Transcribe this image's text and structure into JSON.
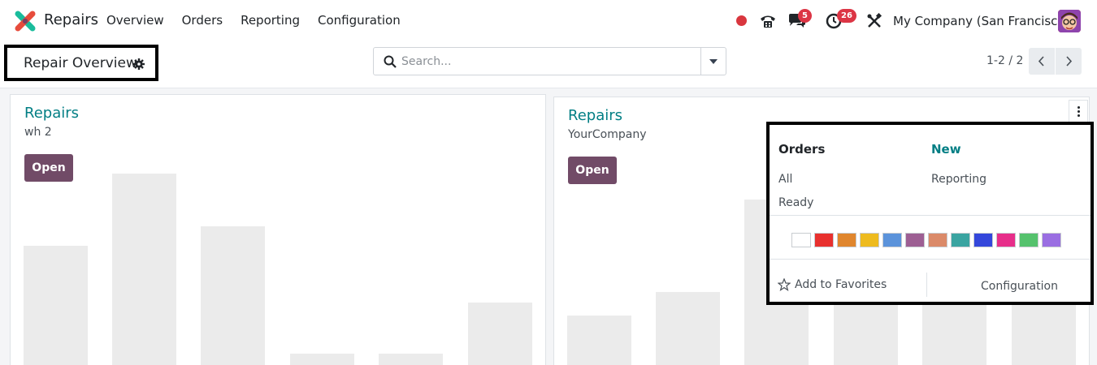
{
  "app": {
    "name": "Repairs",
    "logo_icon": "odoo-repairs-logo"
  },
  "nav": {
    "items": [
      "Overview",
      "Orders",
      "Reporting",
      "Configuration"
    ]
  },
  "systray": {
    "status_color": "#d9363e",
    "chat_count": "5",
    "activity_count": "26",
    "company": "My Company (San Francisco)"
  },
  "control_panel": {
    "title": "Repair Overview",
    "search_placeholder": "Search...",
    "pager": "1-2 / 2"
  },
  "cards": [
    {
      "name": "Repairs",
      "subtitle": "wh 2",
      "button": "Open",
      "graph_values": [
        95,
        150,
        110,
        13,
        13,
        52
      ]
    },
    {
      "name": "Repairs",
      "subtitle": "YourCompany",
      "button": "Open",
      "graph_values": [
        42,
        60,
        130,
        130,
        130,
        130
      ]
    }
  ],
  "dropdown": {
    "orders_title": "Orders",
    "orders_links": [
      "All",
      "Ready"
    ],
    "new_title": "New",
    "new_links": [
      "Reporting"
    ],
    "colors": [
      "#ffffff",
      "#e8302e",
      "#e0862e",
      "#eebb1f",
      "#5b93db",
      "#9d5f93",
      "#db8a69",
      "#3aa4a1",
      "#3447db",
      "#e72e8a",
      "#55c26d",
      "#9a6ee2"
    ],
    "favorites_label": "Add to Favorites",
    "config_label": "Configuration"
  },
  "accent": {
    "primary": "#714b67",
    "link": "#017e84"
  }
}
